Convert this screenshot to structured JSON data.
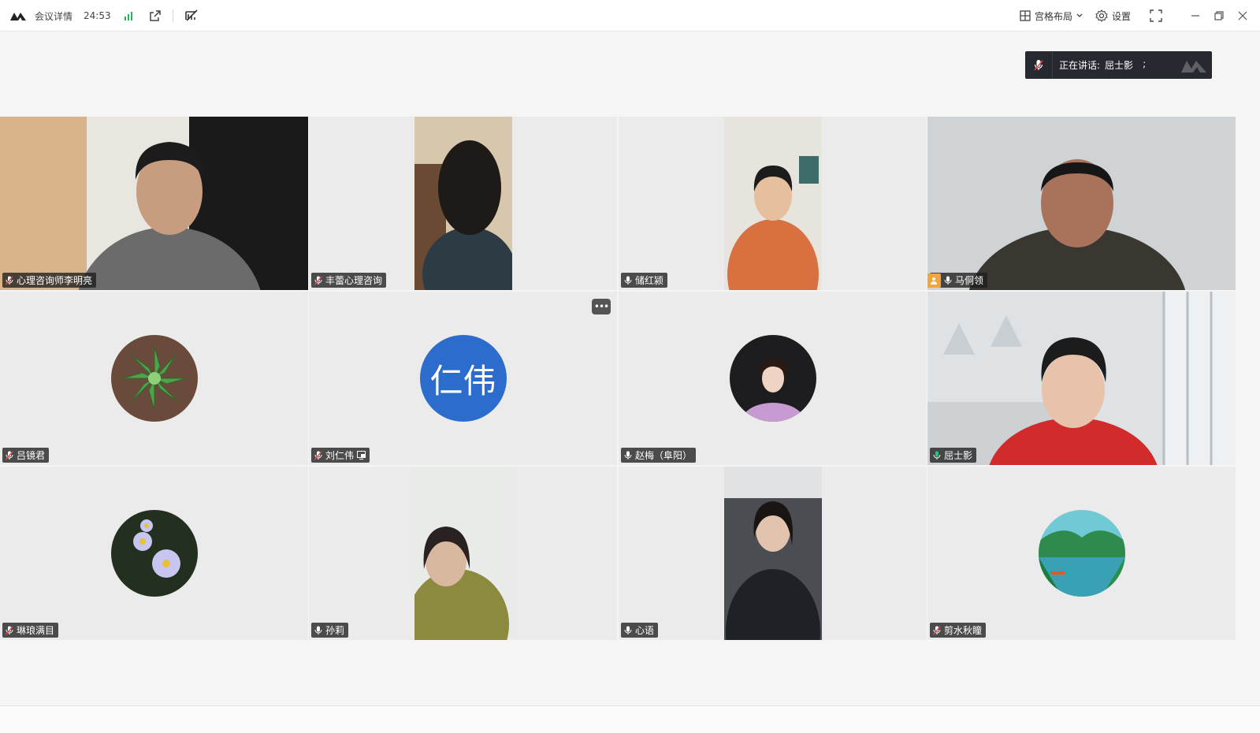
{
  "topbar": {
    "meeting_details": "会议详情",
    "timer": "24:53",
    "layout_label": "宫格布局",
    "settings_label": "设置"
  },
  "speaking": {
    "label": "正在讲话:",
    "name": "屈士影",
    "suffix": ";"
  },
  "participants": [
    {
      "name": "心理咨询师李明亮",
      "mic": "muted",
      "kind": "video"
    },
    {
      "name": "丰蕾心理咨询",
      "mic": "muted",
      "kind": "video"
    },
    {
      "name": "储红颍",
      "mic": "on",
      "kind": "video"
    },
    {
      "name": "马侗领",
      "mic": "on",
      "kind": "video",
      "host": true
    },
    {
      "name": "吕镜君",
      "mic": "muted",
      "kind": "avatar",
      "avatar": "succulent"
    },
    {
      "name": "刘仁伟",
      "mic": "muted",
      "kind": "avatar-text",
      "avatar_text": "仁伟",
      "avatar_color": "#2c6ccc",
      "screen_icon": true
    },
    {
      "name": "赵梅（阜阳）",
      "mic": "on",
      "kind": "avatar",
      "avatar": "portrait"
    },
    {
      "name": "屈士影",
      "mic": "speaking",
      "kind": "video",
      "active": true
    },
    {
      "name": "琳琅满目",
      "mic": "muted",
      "kind": "avatar",
      "avatar": "daisies"
    },
    {
      "name": "孙莉",
      "mic": "on",
      "kind": "video"
    },
    {
      "name": "心语",
      "mic": "on",
      "kind": "video"
    },
    {
      "name": "剪水秋瞳",
      "mic": "muted",
      "kind": "avatar",
      "avatar": "landscape"
    }
  ],
  "colors": {
    "accent_green": "#2bc37c",
    "muted_red": "#e5484d",
    "host_orange": "#f3a43b"
  }
}
